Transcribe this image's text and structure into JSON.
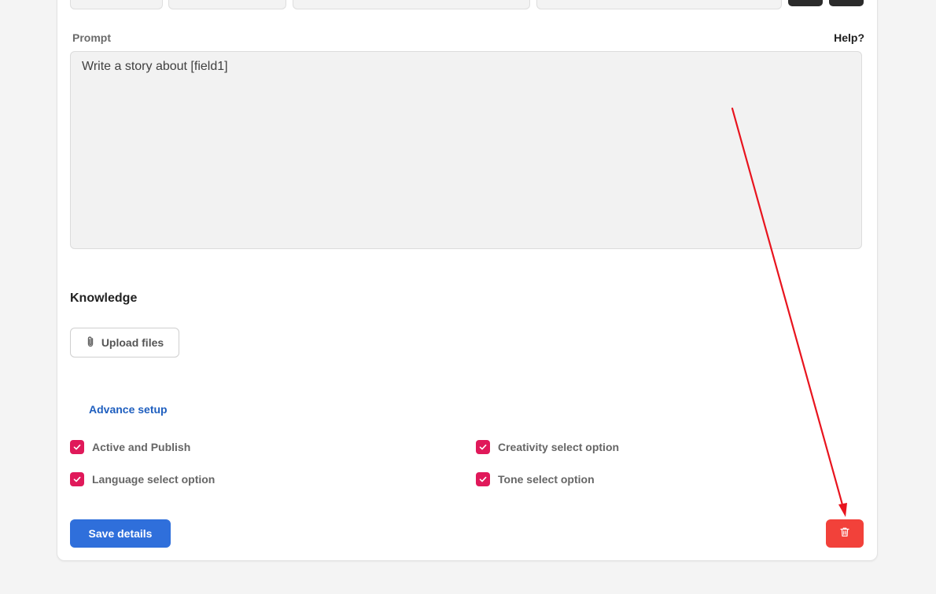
{
  "prompt": {
    "label": "Prompt",
    "help": "Help?",
    "value": "Write a story about [field1]"
  },
  "knowledge": {
    "title": "Knowledge",
    "upload_label": "Upload files"
  },
  "advance_setup": "Advance setup",
  "options": [
    {
      "label": "Active and Publish",
      "checked": true
    },
    {
      "label": "Creativity select option",
      "checked": true
    },
    {
      "label": "Language select option",
      "checked": true
    },
    {
      "label": "Tone select option",
      "checked": true
    }
  ],
  "actions": {
    "save_label": "Save details"
  },
  "colors": {
    "primary": "#2f6fdb",
    "danger": "#f2413a",
    "checkbox": "#e0195a",
    "link": "#1f5fbf",
    "annotation_arrow": "#e8141e"
  },
  "icons": {
    "upload": "paperclip-icon",
    "delete": "trash-icon",
    "check": "check-icon"
  }
}
